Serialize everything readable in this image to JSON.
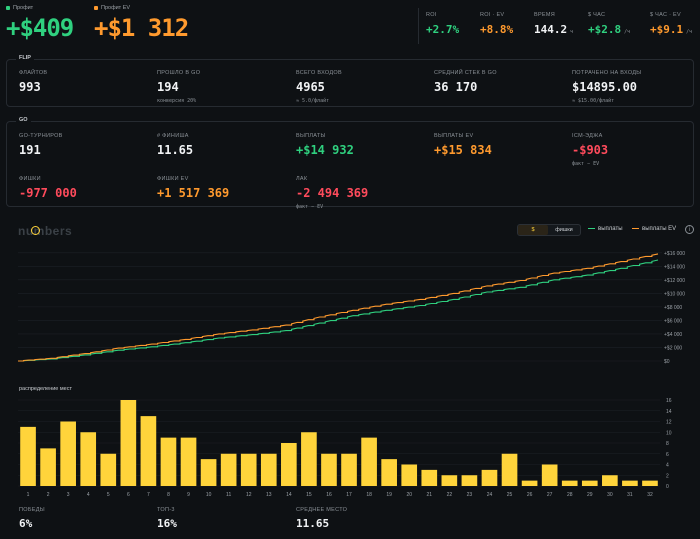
{
  "header": {
    "profit_label": "Профит",
    "profit_value": "+$409",
    "profit_ev_label": "Профит EV",
    "profit_ev_value": "+$1 312",
    "stats": [
      {
        "label": "ROI",
        "value": "+2.7%",
        "unit": "",
        "color": "green"
      },
      {
        "label": "ROI · EV",
        "value": "+8.8%",
        "unit": "",
        "color": "orange"
      },
      {
        "label": "ВРЕМЯ",
        "value": "144.2",
        "unit": "ч",
        "color": "white"
      },
      {
        "label": "$ ЧАС",
        "value": "+$2.8",
        "unit": "/ч",
        "color": "green"
      },
      {
        "label": "$ ЧАС · EV",
        "value": "+$9.1",
        "unit": "/ч",
        "color": "orange"
      }
    ]
  },
  "flip": {
    "tag": "FLIP",
    "items": [
      {
        "label": "ФЛАЙТОВ",
        "value": "993",
        "sub": ""
      },
      {
        "label": "ПРОШЛО В GO",
        "value": "194",
        "sub": "конверсия 20%"
      },
      {
        "label": "ВСЕГО ВХОДОВ",
        "value": "4965",
        "sub": "≈ 5.0/флайт"
      },
      {
        "label": "СРЕДНИЙ СТЕК В GO",
        "value": "36 170",
        "sub": ""
      },
      {
        "label": "ПОТРАЧЕНО НА ВХОДЫ",
        "value": "$14895.00",
        "sub": "≈ $15.00/флайт"
      }
    ]
  },
  "go": {
    "tag": "GO",
    "row1": [
      {
        "label": "GO-ТУРНИРОВ",
        "value": "191",
        "sub": "",
        "color": "white"
      },
      {
        "label": "# ФИНИША",
        "value": "11.65",
        "sub": "",
        "color": "white"
      },
      {
        "label": "ВЫПЛАТЫ",
        "value": "+$14 932",
        "sub": "",
        "color": "green"
      },
      {
        "label": "ВЫПЛАТЫ EV",
        "value": "+$15 834",
        "sub": "",
        "color": "orange"
      },
      {
        "label": "ICM-ЭДЖА",
        "value": "-$903",
        "sub": "факт − EV",
        "color": "red"
      }
    ],
    "row2": [
      {
        "label": "ФИШКИ",
        "value": "-977 000",
        "sub": "",
        "color": "red"
      },
      {
        "label": "ФИШКИ EV",
        "value": "+1 517 369",
        "sub": "",
        "color": "orange"
      },
      {
        "label": "ЛАК",
        "value": "-2 494 369",
        "sub": "факт − EV",
        "color": "red"
      }
    ]
  },
  "chart_toolbar": {
    "logo": "numbers",
    "toggle_dollar": "$",
    "toggle_chips": "фишки",
    "legend_payouts": "выплаты",
    "legend_payouts_ev": "выплаты EV",
    "info": "i"
  },
  "colors": {
    "green": "#2fd07f",
    "orange": "#ff9a2e",
    "red": "#ff4b5c",
    "bar": "#ffd43b"
  },
  "chart_data": [
    {
      "type": "line",
      "title": "",
      "xlabel": "",
      "ylabel": "",
      "ylim": [
        0,
        17000
      ],
      "yticks": [
        0,
        2000,
        4000,
        6000,
        8000,
        10000,
        12000,
        14000,
        16000
      ],
      "ytick_labels": [
        "$0",
        "+$2 000",
        "+$4 000",
        "+$6 000",
        "+$8 000",
        "+$10 000",
        "+$12 000",
        "+$14 000",
        "+$16 000"
      ],
      "x": [
        0,
        10,
        20,
        30,
        40,
        50,
        60,
        70,
        80,
        90,
        100,
        110,
        120,
        130,
        140,
        150,
        160,
        170,
        180,
        191
      ],
      "series": [
        {
          "name": "выплаты",
          "values": [
            0,
            300,
            900,
            1600,
            2100,
            2700,
            3400,
            3900,
            4500,
            5600,
            6700,
            7500,
            8200,
            9100,
            10200,
            10900,
            12000,
            12700,
            13700,
            14932
          ]
        },
        {
          "name": "выплаты EV",
          "values": [
            0,
            400,
            1100,
            1900,
            2500,
            3200,
            4000,
            4600,
            5300,
            6500,
            7500,
            8400,
            9100,
            10000,
            11100,
            11900,
            13000,
            13700,
            14700,
            15834
          ]
        }
      ]
    },
    {
      "type": "bar",
      "title": "распределение мест",
      "categories": [
        "1",
        "2",
        "3",
        "4",
        "5",
        "6",
        "7",
        "8",
        "9",
        "10",
        "11",
        "12",
        "13",
        "14",
        "15",
        "16",
        "17",
        "18",
        "19",
        "20",
        "21",
        "22",
        "23",
        "24",
        "25",
        "26",
        "27",
        "28",
        "29",
        "30",
        "31",
        "32"
      ],
      "values": [
        11,
        7,
        12,
        10,
        6,
        16,
        13,
        9,
        9,
        5,
        6,
        6,
        6,
        8,
        10,
        6,
        6,
        9,
        5,
        4,
        3,
        2,
        2,
        3,
        6,
        1,
        4,
        1,
        1,
        2,
        1,
        1
      ],
      "ylim": [
        0,
        16
      ],
      "yticks": [
        0,
        2,
        4,
        6,
        8,
        10,
        12,
        14,
        16
      ]
    }
  ],
  "bottom": [
    {
      "label": "ПОБЕДЫ",
      "value": "6%"
    },
    {
      "label": "ТОП-3",
      "value": "16%"
    },
    {
      "label": "СРЕДНЕЕ МЕСТО",
      "value": "11.65"
    }
  ]
}
